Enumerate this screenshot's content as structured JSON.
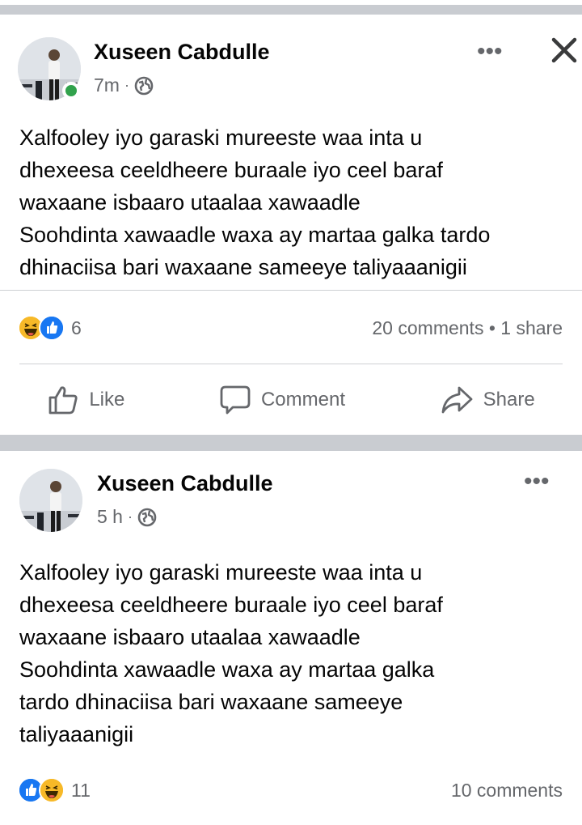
{
  "posts": [
    {
      "author": "Xuseen Cabdulle",
      "time": "7m",
      "meta_sep": "·",
      "privacy_icon": "globe-icon",
      "online": true,
      "more_label": "•••",
      "close_icon": "close-icon",
      "text_lines": [
        "Xalfooley iyo garaski mureeste waa inta u",
        "dhexeesa ceeldheere buraale iyo ceel baraf",
        "waxaane isbaaro utaalaa xawaadle",
        "Soohdinta xawaadle waxa ay martaa galka tardo",
        "dhinaciisa bari waxaane sameeye taliyaaanigii"
      ],
      "reactions": [
        "haha",
        "like"
      ],
      "reaction_count": "6",
      "counts": "20 comments • 1 share",
      "actions": {
        "like": "Like",
        "comment": "Comment",
        "share": "Share"
      }
    },
    {
      "author": "Xuseen Cabdulle",
      "time": "5 h",
      "meta_sep": "·",
      "privacy_icon": "globe-icon",
      "online": false,
      "more_label": "•••",
      "text_lines": [
        "Xalfooley iyo garaski mureeste waa inta u",
        "dhexeesa ceeldheere buraale iyo ceel baraf",
        "waxaane isbaaro utaalaa xawaadle",
        "Soohdinta xawaadle waxa ay martaa galka",
        "tardo dhinaciisa bari waxaane sameeye",
        "taliyaaanigii"
      ],
      "reactions": [
        "like",
        "haha"
      ],
      "reaction_count": "11",
      "counts": "10 comments"
    }
  ],
  "colors": {
    "like_blue": "#1877f2",
    "haha_yellow": "#f7b928",
    "online_green": "#31a24c",
    "separator": "#c9ccd1",
    "secondary_text": "#65676b"
  }
}
